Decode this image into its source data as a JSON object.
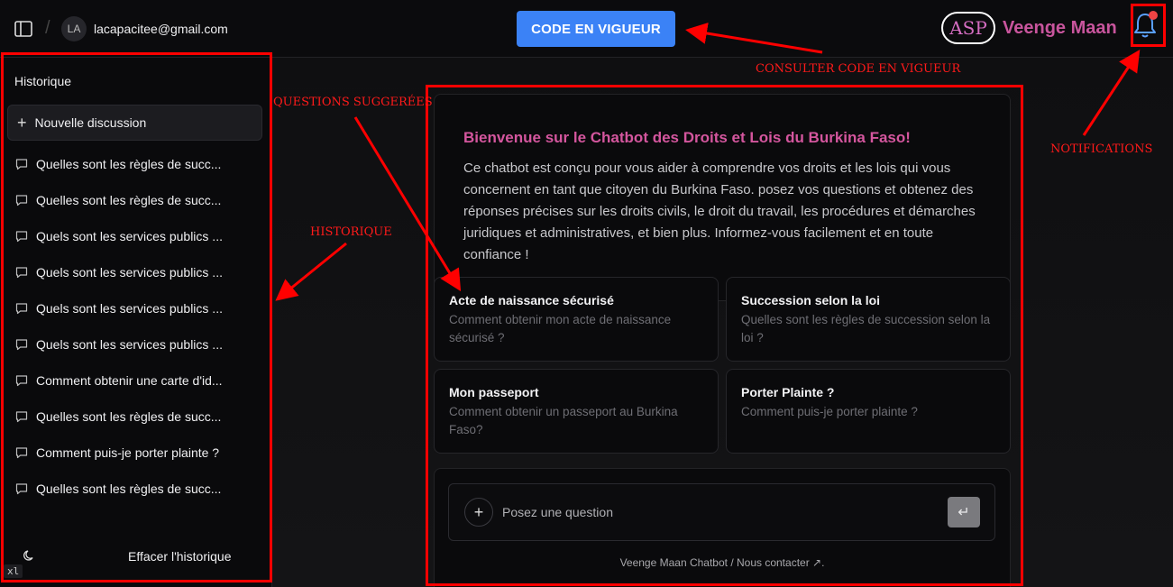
{
  "header": {
    "user_initials": "LA",
    "user_email": "lacapacitee@gmail.com",
    "code_button": "CODE EN VIGUEUR",
    "logo_text": "ASP",
    "brand_name": "Veenge Maan",
    "icons": [
      "sidebar-toggle-icon",
      "bell-icon"
    ]
  },
  "sidebar": {
    "title": "Historique",
    "new_discussion": "Nouvelle discussion",
    "items": [
      "Quelles sont les règles de succ...",
      "Quelles sont les règles de succ...",
      "Quels sont les services publics ...",
      "Quels sont les services publics ...",
      "Quels sont les services publics ...",
      "Quels sont les services publics ...",
      "Comment obtenir une carte d'id...",
      "Quelles sont les règles de succ...",
      "Comment puis-je porter plainte ?",
      "Quelles sont les règles de succ..."
    ],
    "clear_history": "Effacer l'historique",
    "badge": "xl"
  },
  "welcome": {
    "title": "Bienvenue sur le Chatbot des Droits et Lois du Burkina Faso!",
    "text": "Ce chatbot est conçu pour vous aider à comprendre vos droits et les lois qui vous concernent en tant que citoyen du Burkina Faso. posez vos questions et obtenez des réponses précises sur les droits civils, le droit du travail, les procédures et démarches juridiques et administratives, et bien plus. Informez-vous facilement et en toute confiance !"
  },
  "suggestions": [
    {
      "title": "Acte de naissance sécurisé",
      "subtitle": "Comment obtenir mon acte de naissance sécurisé ?"
    },
    {
      "title": "Succession selon la loi",
      "subtitle": "Quelles sont les règles de succession selon la loi ?"
    },
    {
      "title": "Mon passeport",
      "subtitle": "Comment obtenir un passeport au Burkina Faso?"
    },
    {
      "title": "Porter Plainte ?",
      "subtitle": "Comment puis-je porter plainte ?"
    }
  ],
  "input": {
    "placeholder": "Posez une question",
    "footer": "Veenge Maan Chatbot / Nous contacter ↗."
  },
  "annotations": {
    "consulter": "CONSULTER CODE EN VIGUEUR",
    "notifications": "NOTIFICATIONS",
    "questions": "QUESTIONS SUGGERÉES",
    "historique": "HISTORIQUE",
    "color": "#ff0000"
  },
  "colors": {
    "accent": "#3b82f6",
    "brand": "#c9559d",
    "welcome_title": "#d4569e",
    "notification_dot": "#ef4444"
  }
}
